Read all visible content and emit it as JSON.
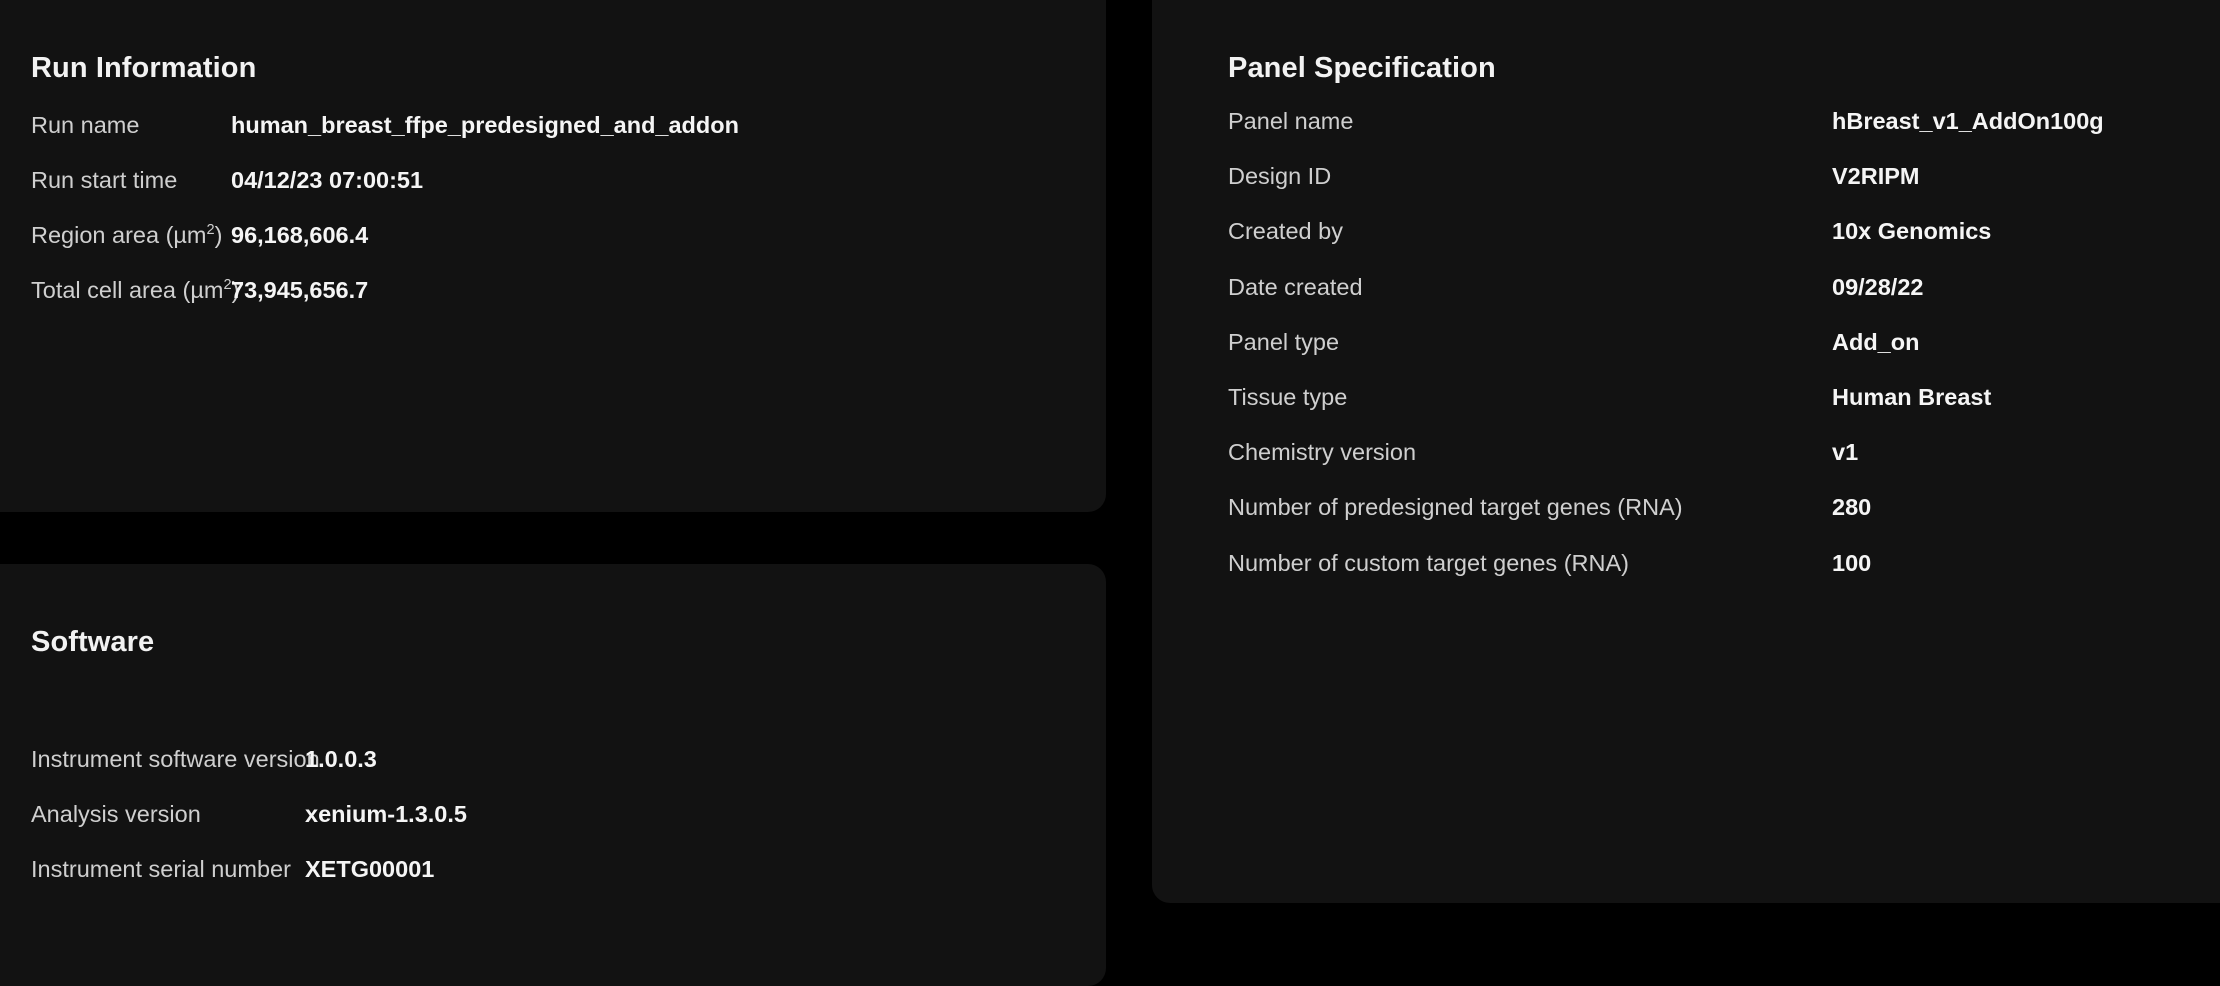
{
  "theme": {
    "page_background": "#000000",
    "card_background": "#121212",
    "label_color": "#cfcfcf",
    "value_color": "#f5f5f5",
    "title_color": "#f2f2f2"
  },
  "run_information": {
    "title": "Run Information",
    "rows": [
      {
        "label": "Run name",
        "value": "human_breast_ffpe_predesigned_and_addon"
      },
      {
        "label": "Run start time",
        "value": "04/12/23 07:00:51"
      },
      {
        "label": "Region area (µm²)",
        "label_base": "Region area (µm",
        "label_sup": "2",
        "label_tail": ")",
        "value": "96,168,606.4"
      },
      {
        "label": "Total cell area (µm²)",
        "label_base": "Total cell area (µm",
        "label_sup": "2",
        "label_tail": ")",
        "value": "73,945,656.7"
      }
    ]
  },
  "software": {
    "title": "Software",
    "rows": [
      {
        "label": "Instrument software version",
        "value": "1.0.0.3"
      },
      {
        "label": "Analysis version",
        "value": "xenium-1.3.0.5"
      },
      {
        "label": "Instrument serial number",
        "value": "XETG00001"
      }
    ]
  },
  "panel_specification": {
    "title": "Panel Specification",
    "rows": [
      {
        "label": "Panel name",
        "value": "hBreast_v1_AddOn100g"
      },
      {
        "label": "Design ID",
        "value": "V2RIPM"
      },
      {
        "label": "Created by",
        "value": "10x Genomics"
      },
      {
        "label": "Date created",
        "value": "09/28/22"
      },
      {
        "label": "Panel type",
        "value": "Add_on"
      },
      {
        "label": "Tissue type",
        "value": "Human Breast"
      },
      {
        "label": "Chemistry version",
        "value": "v1"
      },
      {
        "label": "Number of predesigned target genes (RNA)",
        "value": "280"
      },
      {
        "label": "Number of custom target genes (RNA)",
        "value": "100"
      }
    ]
  }
}
